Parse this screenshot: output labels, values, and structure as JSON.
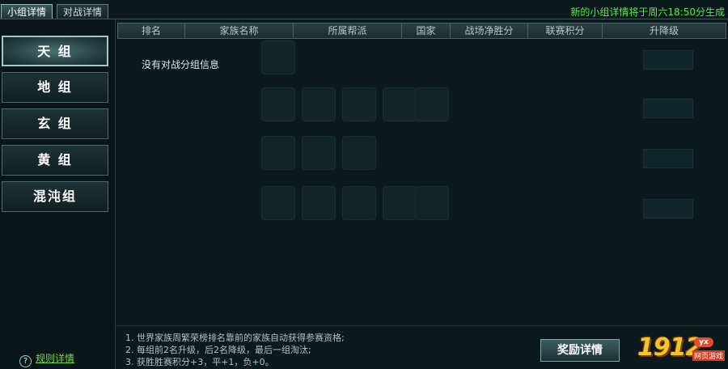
{
  "tabs": [
    {
      "label": "小组详情",
      "active": true
    },
    {
      "label": "对战详情",
      "active": false
    }
  ],
  "notice": "新的小组详情将于周六18:50分生成",
  "groups": [
    {
      "label": "天 组",
      "active": true
    },
    {
      "label": "地 组",
      "active": false
    },
    {
      "label": "玄 组",
      "active": false
    },
    {
      "label": "黄 组",
      "active": false
    },
    {
      "label": "混沌组",
      "active": false
    }
  ],
  "rule_link": "规则详情",
  "table": {
    "headers": [
      "排名",
      "家族名称",
      "所属帮派",
      "国家",
      "战场净胜分",
      "联赛积分",
      "升降级"
    ],
    "empty_message": "没有对战分组信息"
  },
  "notes": [
    "1. 世界家族周繁荣榜排名靠前的家族自动获得参赛资格;",
    "2. 每组前2名升级，后2名降级，最后一组淘汰;",
    "3. 获胜胜赛积分+3，平+1，负+0。"
  ],
  "reward_button": "奖励详情",
  "logo": {
    "number": "1912",
    "badge": "yx",
    "caption": "网页游戏"
  },
  "colors": {
    "notice": "#4ef23e",
    "rule_link": "#7bd64a",
    "logo": "#f3c62b"
  }
}
